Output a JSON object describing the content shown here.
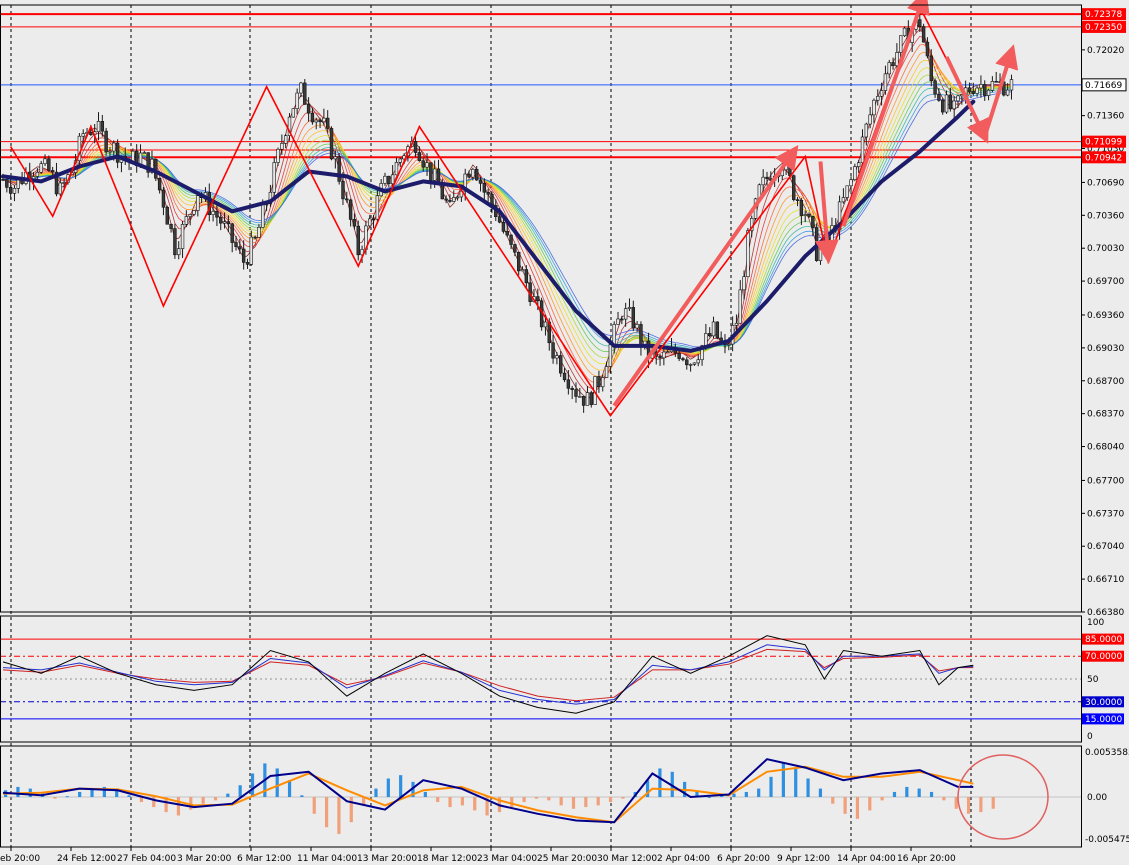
{
  "chart_data": {
    "type": "candlestick",
    "instrument_hint": "",
    "colors": {
      "background": "#ececec",
      "bull_candle": "#e8e8e8",
      "bear_candle": "#3a3a3a",
      "wick": "#1a1a1a",
      "slow_ma": "#1c1c6b",
      "resistance_line": "#ff0000",
      "current_price_line": "#2255ff",
      "zigzag": "#ff0000",
      "forecast_arrow": "#f25c5c",
      "histogram_pos": "#2f8fe0",
      "histogram_neg": "#f0a07a",
      "macd_line": "#00008b",
      "signal_line": "#ff8c00",
      "circle": "#e06060"
    },
    "price_axis": {
      "ticks": [
        "0.72020",
        "0.71690",
        "0.71360",
        "0.71030",
        "0.70690",
        "0.70360",
        "0.70030",
        "0.69700",
        "0.69360",
        "0.69030",
        "0.68700",
        "0.68370",
        "0.68040",
        "0.67700",
        "0.67370",
        "0.67040",
        "0.66710",
        "0.66380"
      ],
      "range": [
        0.6638,
        0.7247
      ]
    },
    "price_tags": [
      {
        "label": "0.72378",
        "value": 0.72378,
        "kind": "red"
      },
      {
        "label": "0.72350",
        "value": 0.7225,
        "kind": "red"
      },
      {
        "label": "0.71669",
        "value": 0.71669,
        "kind": "current"
      },
      {
        "label": "0.71099",
        "value": 0.71099,
        "kind": "red"
      },
      {
        "label": "0.70942",
        "value": 0.70942,
        "kind": "red"
      }
    ],
    "horizontal_levels": [
      0.72378,
      0.7225,
      0.71669,
      0.71099,
      0.70942,
      0.71015
    ],
    "time_axis": [
      "eb 20:00",
      "24 Feb 12:00",
      "27 Feb 04:00",
      "3 Mar 20:00",
      "6 Mar 12:00",
      "11 Mar 04:00",
      "13 Mar 20:00",
      "18 Mar 12:00",
      "23 Mar 04:00",
      "25 Mar 20:00",
      "30 Mar 12:00",
      "2 Apr 04:00",
      "6 Apr 20:00",
      "9 Apr 12:00",
      "14 Apr 04:00",
      "16 Apr 20:00"
    ],
    "vertical_separators": [
      11,
      131,
      250,
      371,
      491,
      611,
      731,
      851,
      971
    ],
    "close_path": [
      [
        0,
        0.7072
      ],
      [
        3,
        0.7065
      ],
      [
        6,
        0.7078
      ],
      [
        9,
        0.7086
      ],
      [
        12,
        0.708
      ],
      [
        15,
        0.706
      ],
      [
        18,
        0.708
      ],
      [
        21,
        0.7118
      ],
      [
        24,
        0.7125
      ],
      [
        27,
        0.711
      ],
      [
        30,
        0.71
      ],
      [
        33,
        0.709
      ],
      [
        36,
        0.7095
      ],
      [
        39,
        0.7085
      ],
      [
        42,
        0.705
      ],
      [
        45,
        0.7005
      ],
      [
        48,
        0.703
      ],
      [
        51,
        0.706
      ],
      [
        54,
        0.7045
      ],
      [
        57,
        0.703
      ],
      [
        60,
        0.701
      ],
      [
        63,
        0.699
      ],
      [
        66,
        0.701
      ],
      [
        69,
        0.705
      ],
      [
        72,
        0.7095
      ],
      [
        75,
        0.714
      ],
      [
        78,
        0.716
      ],
      [
        81,
        0.714
      ],
      [
        84,
        0.7125
      ],
      [
        87,
        0.709
      ],
      [
        90,
        0.7045
      ],
      [
        93,
        0.7
      ],
      [
        96,
        0.703
      ],
      [
        99,
        0.706
      ],
      [
        102,
        0.708
      ],
      [
        105,
        0.71
      ],
      [
        108,
        0.711
      ],
      [
        111,
        0.7085
      ],
      [
        114,
        0.7065
      ],
      [
        117,
        0.704
      ],
      [
        120,
        0.707
      ],
      [
        123,
        0.709
      ],
      [
        126,
        0.706
      ],
      [
        129,
        0.704
      ],
      [
        132,
        0.701
      ],
      [
        135,
        0.6985
      ],
      [
        138,
        0.696
      ],
      [
        141,
        0.693
      ],
      [
        144,
        0.69
      ],
      [
        147,
        0.688
      ],
      [
        150,
        0.686
      ],
      [
        153,
        0.685
      ],
      [
        156,
        0.687
      ],
      [
        159,
        0.6905
      ],
      [
        162,
        0.694
      ],
      [
        165,
        0.693
      ],
      [
        168,
        0.69
      ],
      [
        171,
        0.689
      ],
      [
        174,
        0.6895
      ],
      [
        177,
        0.69
      ],
      [
        180,
        0.689
      ],
      [
        183,
        0.6905
      ],
      [
        186,
        0.692
      ],
      [
        189,
        0.69
      ],
      [
        192,
        0.693
      ],
      [
        195,
        0.701
      ],
      [
        198,
        0.706
      ],
      [
        201,
        0.708
      ],
      [
        204,
        0.709
      ],
      [
        207,
        0.706
      ],
      [
        210,
        0.704
      ],
      [
        213,
        0.7
      ],
      [
        216,
        0.701
      ],
      [
        219,
        0.704
      ],
      [
        222,
        0.707
      ],
      [
        225,
        0.711
      ],
      [
        228,
        0.715
      ],
      [
        231,
        0.718
      ],
      [
        234,
        0.72
      ],
      [
        237,
        0.722
      ],
      [
        240,
        0.723
      ],
      [
        243,
        0.717
      ],
      [
        246,
        0.715
      ],
      [
        249,
        0.714
      ],
      [
        252,
        0.716
      ],
      [
        254,
        0.7167
      ]
    ],
    "slow_ma_path": [
      [
        0,
        0.7075
      ],
      [
        10,
        0.707
      ],
      [
        20,
        0.7085
      ],
      [
        30,
        0.7095
      ],
      [
        40,
        0.708
      ],
      [
        50,
        0.706
      ],
      [
        60,
        0.704
      ],
      [
        70,
        0.705
      ],
      [
        80,
        0.708
      ],
      [
        90,
        0.7075
      ],
      [
        100,
        0.706
      ],
      [
        110,
        0.707
      ],
      [
        120,
        0.7065
      ],
      [
        130,
        0.704
      ],
      [
        140,
        0.699
      ],
      [
        150,
        0.694
      ],
      [
        160,
        0.6905
      ],
      [
        170,
        0.6905
      ],
      [
        180,
        0.69
      ],
      [
        190,
        0.691
      ],
      [
        200,
        0.695
      ],
      [
        210,
        0.6995
      ],
      [
        220,
        0.703
      ],
      [
        230,
        0.707
      ],
      [
        240,
        0.71
      ],
      [
        250,
        0.7135
      ],
      [
        254,
        0.715
      ]
    ],
    "zigzag_path": [
      [
        2,
        0.7105
      ],
      [
        13,
        0.7035
      ],
      [
        23,
        0.7125
      ],
      [
        42,
        0.6945
      ],
      [
        69,
        0.7165
      ],
      [
        93,
        0.6985
      ],
      [
        109,
        0.7125
      ],
      [
        159,
        0.6835
      ],
      [
        210,
        0.7095
      ],
      [
        216,
        0.699
      ],
      [
        240,
        0.7245
      ],
      [
        254,
        0.714
      ]
    ],
    "forecast_arrows": [
      [
        [
          160,
          0.6845
        ],
        [
          207,
          0.71
        ]
      ],
      [
        [
          214,
          0.709
        ],
        [
          216,
          0.6995
        ]
      ],
      [
        [
          220,
          0.7025
        ],
        [
          241,
          0.7255
        ]
      ],
      [
        [
          247,
          0.7195
        ],
        [
          257,
          0.7115
        ]
      ],
      [
        [
          257,
          0.7115
        ],
        [
          264,
          0.72
        ]
      ]
    ],
    "oscillator": {
      "levels": [
        {
          "label": "85.0000",
          "value": 85,
          "style": "solid",
          "color": "#ff0000"
        },
        {
          "label": "70.0000",
          "value": 70,
          "style": "dash",
          "color": "#ff0000"
        },
        {
          "label": "30.0000",
          "value": 30,
          "style": "dash",
          "color": "#0000cc"
        },
        {
          "label": "15.0000",
          "value": 15,
          "style": "solid",
          "color": "#0000ff"
        }
      ],
      "ticks": [
        "100",
        "50",
        "0"
      ],
      "range": [
        0,
        100
      ],
      "fast": [
        [
          0,
          65
        ],
        [
          10,
          55
        ],
        [
          20,
          70
        ],
        [
          30,
          55
        ],
        [
          40,
          45
        ],
        [
          50,
          40
        ],
        [
          60,
          45
        ],
        [
          70,
          75
        ],
        [
          80,
          65
        ],
        [
          90,
          35
        ],
        [
          100,
          55
        ],
        [
          110,
          72
        ],
        [
          120,
          55
        ],
        [
          130,
          35
        ],
        [
          140,
          25
        ],
        [
          150,
          20
        ],
        [
          160,
          30
        ],
        [
          170,
          70
        ],
        [
          180,
          55
        ],
        [
          190,
          70
        ],
        [
          200,
          88
        ],
        [
          210,
          80
        ],
        [
          215,
          50
        ],
        [
          220,
          75
        ],
        [
          230,
          70
        ],
        [
          240,
          75
        ],
        [
          245,
          45
        ],
        [
          250,
          60
        ],
        [
          254,
          62
        ]
      ],
      "slow": [
        [
          0,
          60
        ],
        [
          10,
          58
        ],
        [
          20,
          64
        ],
        [
          30,
          56
        ],
        [
          40,
          48
        ],
        [
          50,
          45
        ],
        [
          60,
          47
        ],
        [
          70,
          68
        ],
        [
          80,
          64
        ],
        [
          90,
          42
        ],
        [
          100,
          53
        ],
        [
          110,
          66
        ],
        [
          120,
          56
        ],
        [
          130,
          40
        ],
        [
          140,
          32
        ],
        [
          150,
          28
        ],
        [
          160,
          32
        ],
        [
          170,
          62
        ],
        [
          180,
          58
        ],
        [
          190,
          65
        ],
        [
          200,
          80
        ],
        [
          210,
          76
        ],
        [
          215,
          58
        ],
        [
          220,
          70
        ],
        [
          230,
          70
        ],
        [
          240,
          72
        ],
        [
          245,
          55
        ],
        [
          250,
          60
        ],
        [
          254,
          61
        ]
      ],
      "extra": [
        [
          0,
          58
        ],
        [
          10,
          56
        ],
        [
          20,
          62
        ],
        [
          30,
          55
        ],
        [
          40,
          50
        ],
        [
          50,
          47
        ],
        [
          60,
          48
        ],
        [
          70,
          65
        ],
        [
          80,
          62
        ],
        [
          90,
          45
        ],
        [
          100,
          52
        ],
        [
          110,
          64
        ],
        [
          120,
          56
        ],
        [
          130,
          44
        ],
        [
          140,
          35
        ],
        [
          150,
          31
        ],
        [
          160,
          34
        ],
        [
          170,
          58
        ],
        [
          180,
          58
        ],
        [
          190,
          63
        ],
        [
          200,
          76
        ],
        [
          210,
          74
        ],
        [
          215,
          60
        ],
        [
          220,
          68
        ],
        [
          230,
          69
        ],
        [
          240,
          71
        ],
        [
          245,
          57
        ],
        [
          250,
          60
        ],
        [
          254,
          60
        ]
      ]
    },
    "macd": {
      "ticks": [
        "0.0053585",
        "0.00",
        "-0.005475"
      ],
      "range": [
        -0.005475,
        0.0053585
      ],
      "histogram": [
        0.0008,
        0.0012,
        0.001,
        0.0004,
        -0.0002,
        0.0001,
        0.0006,
        0.001,
        0.0012,
        0.0008,
        0.0002,
        -0.0006,
        -0.0012,
        -0.0018,
        -0.0022,
        -0.0015,
        -0.0008,
        -0.0004,
        0.0004,
        0.0014,
        0.0028,
        0.004,
        0.0034,
        0.002,
        0.0002,
        -0.002,
        -0.0036,
        -0.0044,
        -0.003,
        -0.001,
        0.001,
        0.0022,
        0.0026,
        0.0018,
        0.0006,
        -0.0006,
        -0.0012,
        -0.001,
        -0.0016,
        -0.0022,
        -0.0018,
        -0.0012,
        -0.0006,
        -0.0002,
        -0.0004,
        -0.001,
        -0.0014,
        -0.0012,
        -0.001,
        -0.0006,
        -0.0002,
        0.0006,
        0.002,
        0.0034,
        0.003,
        0.0018,
        0.0006,
        0.0,
        0.0002,
        0.0004,
        0.0006,
        0.001,
        0.0024,
        0.004,
        0.0034,
        0.0022,
        0.001,
        -0.0008,
        -0.002,
        -0.0026,
        -0.0016,
        -0.0004,
        0.0006,
        0.0012,
        0.001,
        0.0006,
        -0.0004,
        -0.0014,
        -0.002,
        -0.0018,
        -0.0014
      ],
      "macd_line": [
        [
          0,
          0.0005
        ],
        [
          10,
          0.0002
        ],
        [
          20,
          0.001
        ],
        [
          30,
          0.0008
        ],
        [
          40,
          -0.0004
        ],
        [
          50,
          -0.0012
        ],
        [
          60,
          -0.0008
        ],
        [
          70,
          0.0025
        ],
        [
          80,
          0.003
        ],
        [
          90,
          -0.0005
        ],
        [
          100,
          -0.0015
        ],
        [
          110,
          0.002
        ],
        [
          120,
          0.001
        ],
        [
          130,
          -0.001
        ],
        [
          140,
          -0.002
        ],
        [
          150,
          -0.0028
        ],
        [
          160,
          -0.003
        ],
        [
          170,
          0.0028
        ],
        [
          180,
          0.0
        ],
        [
          190,
          0.0003
        ],
        [
          200,
          0.0045
        ],
        [
          210,
          0.0035
        ],
        [
          220,
          0.002
        ],
        [
          230,
          0.0028
        ],
        [
          240,
          0.0032
        ],
        [
          245,
          0.0022
        ],
        [
          250,
          0.0012
        ],
        [
          254,
          0.0012
        ]
      ],
      "signal_line": [
        [
          0,
          0.0004
        ],
        [
          10,
          0.0005
        ],
        [
          20,
          0.001
        ],
        [
          30,
          0.0009
        ],
        [
          40,
          0.0001
        ],
        [
          50,
          -0.001
        ],
        [
          60,
          -0.0009
        ],
        [
          70,
          0.001
        ],
        [
          80,
          0.0028
        ],
        [
          90,
          0.0008
        ],
        [
          100,
          -0.001
        ],
        [
          110,
          0.0008
        ],
        [
          120,
          0.0012
        ],
        [
          130,
          -0.0004
        ],
        [
          140,
          -0.0016
        ],
        [
          150,
          -0.0024
        ],
        [
          160,
          -0.003
        ],
        [
          170,
          0.001
        ],
        [
          180,
          0.0008
        ],
        [
          190,
          0.0002
        ],
        [
          200,
          0.003
        ],
        [
          210,
          0.0036
        ],
        [
          220,
          0.0024
        ],
        [
          230,
          0.0024
        ],
        [
          240,
          0.003
        ],
        [
          250,
          0.002
        ],
        [
          254,
          0.0016
        ]
      ]
    }
  }
}
